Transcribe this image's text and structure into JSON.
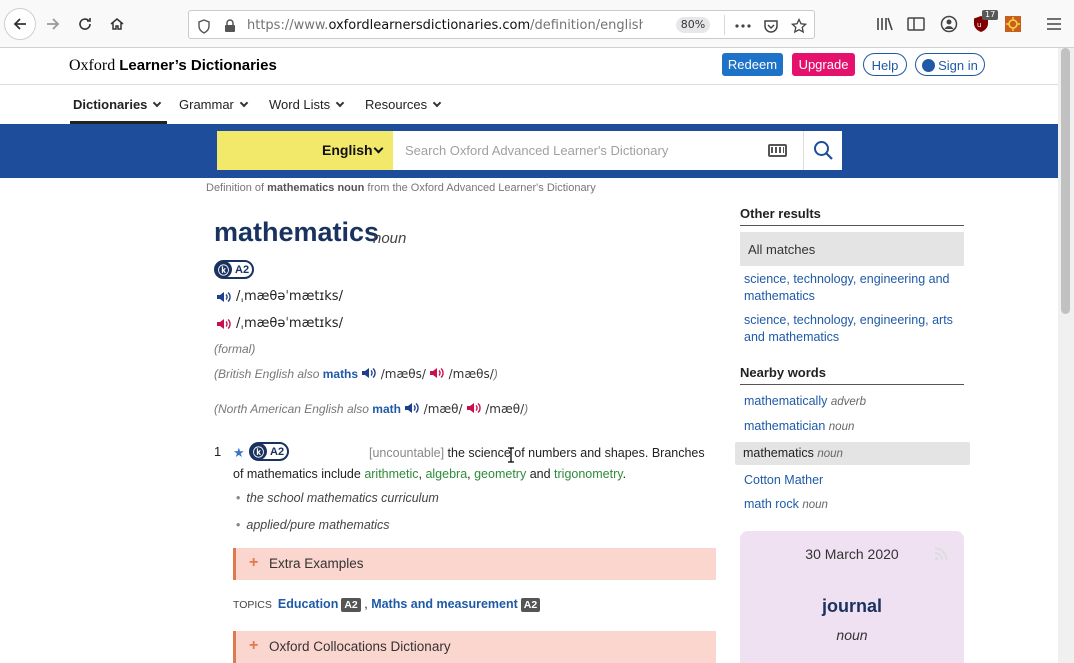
{
  "browser": {
    "url_prefix": "https://www.",
    "url_host": "oxfordlearnersdictionaries.com",
    "url_path": "/definition/english/mathe",
    "zoom": "80%",
    "ublock_count": "17"
  },
  "site": {
    "logo_prefix": "Oxford ",
    "logo_bold": "Learner’s Dictionaries",
    "redeem": "Redeem",
    "upgrade": "Upgrade",
    "help": "Help",
    "signin": "Sign in",
    "colors": {
      "brand_blue": "#1e4d9c",
      "upgrade_pink": "#e5126d",
      "redeem_blue": "#1e73c9",
      "lang_yellow": "#f2e96b"
    }
  },
  "menu": {
    "items": [
      "Dictionaries",
      "Grammar",
      "Word Lists",
      "Resources"
    ]
  },
  "search": {
    "language": "English",
    "placeholder": "Search Oxford Advanced Learner's Dictionary"
  },
  "entry": {
    "breadcrumb_pre": "Definition of ",
    "breadcrumb_bold": "mathematics noun",
    "breadcrumb_post": " from the Oxford Advanced Learner's Dictionary",
    "headword": "mathematics",
    "pos": "noun",
    "level": "A2",
    "phon_uk": "/ˌmæθəˈmætɪks/",
    "phon_us": "/ˌmæθəˈmætɪks/",
    "register": "(formal)",
    "br_prefix": "(British English also ",
    "br_word": "maths",
    "br_uk": "/mæθs/",
    "br_us": "/mæθs/",
    "close_paren": ")",
    "na_prefix": "(North American English also ",
    "na_word": "math",
    "na_uk": "/mæθ/",
    "na_us": "/mæθ/",
    "sense": {
      "num": "1",
      "level": "A2",
      "grammar": "[uncountable]",
      "def1": " the science of numbers and shapes. Branches of mathematics include ",
      "xr1": "arithmetic",
      "sep1": ", ",
      "xr2": "algebra",
      "sep2": ", ",
      "xr3": "geometry",
      "and": " and ",
      "xr4": "trigonometry",
      "end": "."
    },
    "examples": [
      "the school mathematics curriculum",
      "applied/pure mathematics"
    ],
    "extra_examples": "Extra Examples",
    "topics_label": "TOPICS",
    "topic1": "Education",
    "topic1_level": "A2",
    "topic_sep": " , ",
    "topic2": "Maths and measurement",
    "topic2_level": "A2",
    "collocations": "Oxford Collocations Dictionary"
  },
  "sidebar": {
    "other_results": "Other results",
    "all_matches": "All matches",
    "matches": [
      "science, technology, engineering and mathematics",
      "science, technology, engineering, arts and mathematics"
    ],
    "nearby_words": "Nearby words",
    "nearby": [
      {
        "word": "mathematically",
        "pos": "adverb"
      },
      {
        "word": "mathematician",
        "pos": "noun"
      },
      {
        "word": "mathematics",
        "pos": "noun"
      },
      {
        "word": "Cotton Mather",
        "pos": ""
      },
      {
        "word": "math rock",
        "pos": "noun"
      }
    ],
    "wotd_date": "30 March 2020",
    "wotd_word": "journal",
    "wotd_pos": "noun"
  }
}
